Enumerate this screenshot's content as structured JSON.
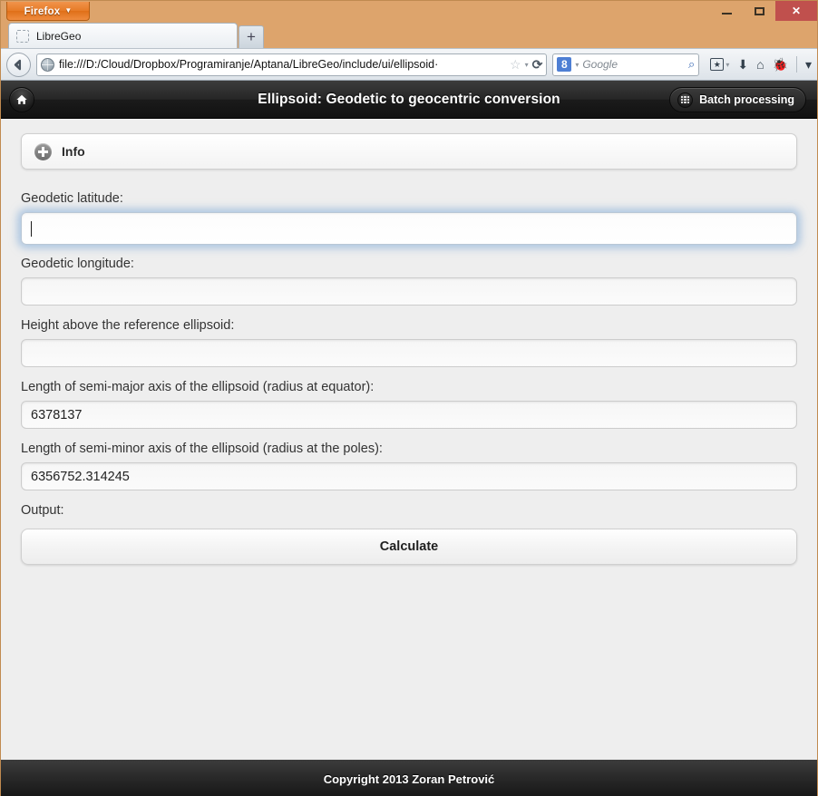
{
  "browser": {
    "app_button_label": "Firefox",
    "window_controls": {
      "minimize": "minimize-icon",
      "maximize": "maximize-icon",
      "close": "✕"
    },
    "tab": {
      "label": "LibreGeo",
      "favicon": "favicon-placeholder-icon"
    },
    "new_tab_label": "+",
    "back_arrow": "←",
    "url": "file:///D:/Cloud/Dropbox/Programiranje/Aptana/LibreGeo/include/ui/ellipsoid·",
    "url_icons": {
      "star": "☆",
      "dropdown": "▾",
      "reload": "⟳"
    },
    "search": {
      "engine_logo": "8",
      "placeholder": "Google",
      "magnifier": "⌕"
    },
    "toolbar_icons": {
      "bookmarks_star": "★",
      "bookmarks_caret": "▾",
      "downloads": "⬇",
      "home": "⌂",
      "addon": "🐞",
      "overflow_caret": "▾"
    }
  },
  "page": {
    "header": {
      "home_icon": "home-icon",
      "title": "Ellipsoid: Geodetic to geocentric conversion",
      "batch_button_label": "Batch processing",
      "batch_button_icon": "grid-dots-icon"
    },
    "info_section": {
      "icon": "plus-circle-icon",
      "label": "Info"
    },
    "fields": [
      {
        "label": "Geodetic latitude:",
        "value": "",
        "focused": true
      },
      {
        "label": "Geodetic longitude:",
        "value": "",
        "focused": false
      },
      {
        "label": "Height above the reference ellipsoid:",
        "value": "",
        "focused": false
      },
      {
        "label": "Length of semi-major axis of the ellipsoid (radius at equator):",
        "value": "6378137",
        "focused": false
      },
      {
        "label": "Length of semi-minor axis of the ellipsoid (radius at the poles):",
        "value": "6356752.314245",
        "focused": false
      }
    ],
    "output_label": "Output:",
    "calculate_button_label": "Calculate",
    "footer_text": "Copyright 2013 Zoran Petrović"
  },
  "colors": {
    "frame": "#dda46c",
    "firefox_orange": "#e77b27",
    "header_dark": "#1b1b1b",
    "page_bg": "#eeeeee",
    "focus_glow": "#78a5d7",
    "close_red": "#c0504d"
  }
}
